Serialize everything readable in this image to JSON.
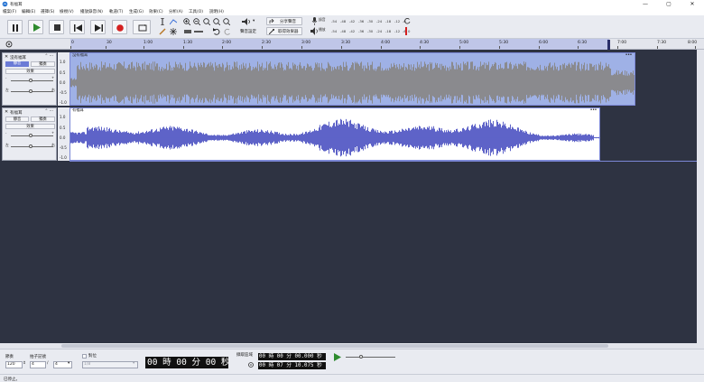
{
  "window": {
    "title": "有福耳",
    "minimize": "—",
    "maximize": "▢",
    "close": "✕"
  },
  "menu": [
    "檔案(F)",
    "編輯(E)",
    "選擇(S)",
    "檢視(V)",
    "播放錄音(N)",
    "軌道(T)",
    "生成(G)",
    "效果(C)",
    "分析(A)",
    "工具(O)",
    "說明(H)"
  ],
  "toolbar": {
    "audio_setup": "聲音設定",
    "share_audio": "分享聲音",
    "get_effects": "取得效果器",
    "meter_ticks": [
      "-54",
      "-48",
      "-42",
      "-36",
      "-30",
      "-24",
      "-18",
      "-12",
      "-6",
      "0"
    ],
    "record_meter_label": "錄音",
    "play_meter_label": "播放"
  },
  "ruler": {
    "ticks": [
      "0",
      "30",
      "1:00",
      "1:30",
      "2:00",
      "2:30",
      "3:00",
      "3:30",
      "4:00",
      "4:30",
      "5:00",
      "5:30",
      "6:00",
      "6:30",
      "7:00",
      "7:30",
      "8:00"
    ]
  },
  "tracks": [
    {
      "name": "沒有福耳",
      "clip_name": "沒有福耳",
      "mute": "靜音",
      "solo": "獨奏",
      "effects": "效果",
      "gain_minus": "-",
      "gain_plus": "+",
      "pan_left": "左",
      "pan_right": "右",
      "scale": [
        "1.0",
        "0.5",
        "0.0",
        "-0.5",
        "-1.0"
      ],
      "wave_color": "#8a8a8e"
    },
    {
      "name": "有福耳",
      "clip_name": "有福耳",
      "mute": "靜音",
      "solo": "獨奏",
      "effects": "效果",
      "gain_minus": "-",
      "gain_plus": "+",
      "pan_left": "左",
      "pan_right": "右",
      "scale": [
        "1.0",
        "0.5",
        "0.0",
        "-0.5",
        "-1.0"
      ],
      "wave_color": "#5e63c8"
    }
  ],
  "bottom": {
    "project_rate_label": "節奏",
    "project_rate": "120",
    "time_sig_label": "拍子記號",
    "time_sig_num": "4",
    "time_sig_den": "4",
    "snap_label": "對位",
    "snap_value": "1/8",
    "big_time": "00 時 00 分 00 秒",
    "selection_label": "擷取區域",
    "sel_start": "00 時 00 分 00.000 秒",
    "sel_end": "00 時 07 分 10.075 秒"
  },
  "status": "已停止。",
  "colors": {
    "accent": "#6b7bd6",
    "track_bg": "#2e3342",
    "selection": "#bfc6e8"
  }
}
